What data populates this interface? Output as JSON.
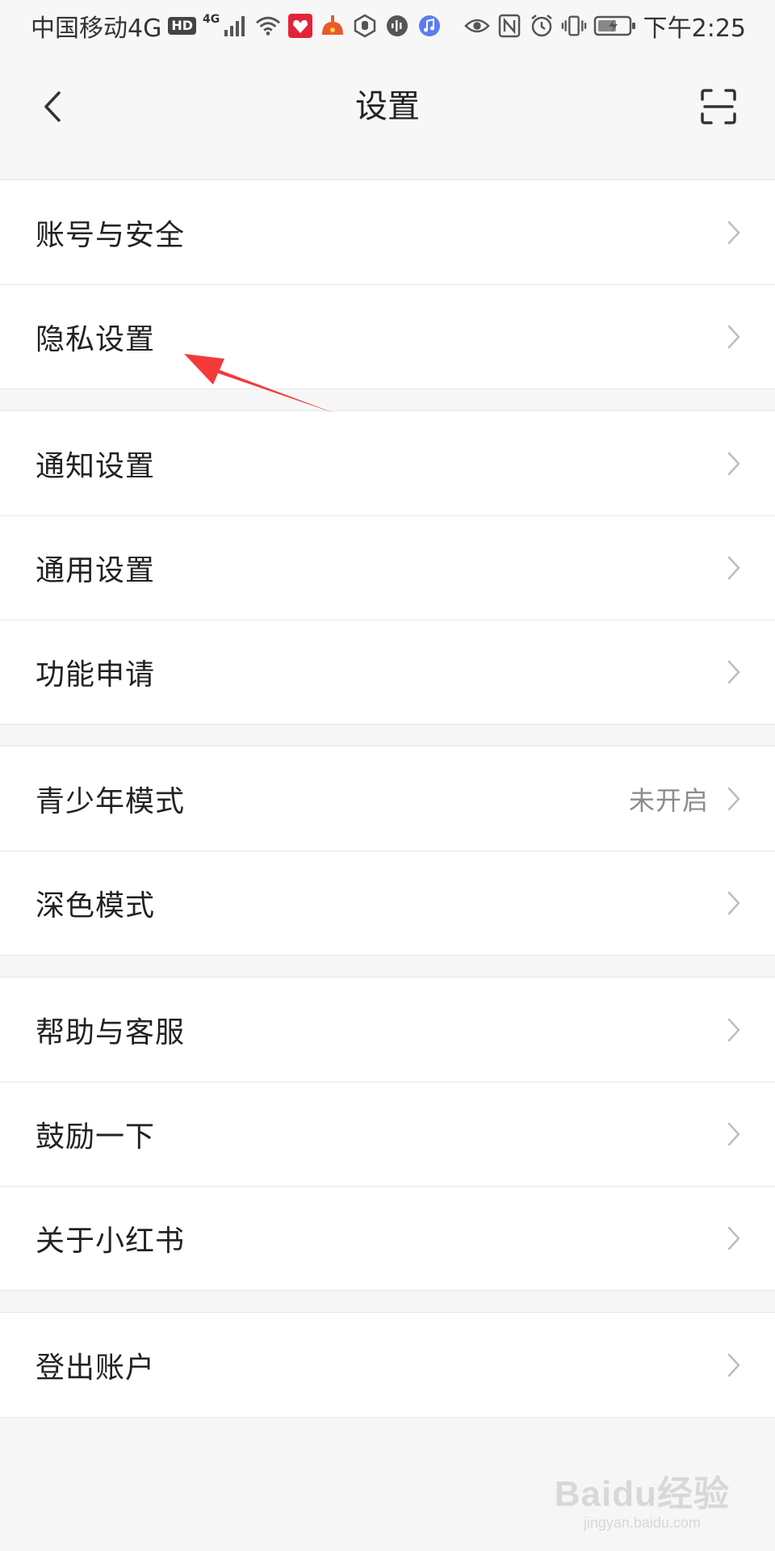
{
  "status_bar": {
    "carrier": "中国移动4G",
    "hd_badge": "HD",
    "network_badge": "4G",
    "time": "下午2:25",
    "icons": [
      "hd-icon",
      "signal-icon",
      "wifi-icon",
      "app-icon",
      "app-icon",
      "app-icon",
      "app-icon",
      "music-icon",
      "eye-icon",
      "nfc-icon",
      "alarm-icon",
      "vibrate-icon",
      "battery-icon"
    ]
  },
  "header": {
    "title": "设置",
    "left_icon": "chevron-left-icon",
    "right_icon": "scan-icon"
  },
  "groups": [
    {
      "items": [
        {
          "label": "账号与安全"
        },
        {
          "label": "隐私设置"
        }
      ]
    },
    {
      "items": [
        {
          "label": "通知设置"
        },
        {
          "label": "通用设置"
        },
        {
          "label": "功能申请"
        }
      ]
    },
    {
      "items": [
        {
          "label": "青少年模式",
          "value": "未开启"
        },
        {
          "label": "深色模式"
        }
      ]
    },
    {
      "items": [
        {
          "label": "帮助与客服"
        },
        {
          "label": "鼓励一下"
        },
        {
          "label": "关于小红书"
        }
      ]
    },
    {
      "items": [
        {
          "label": "登出账户"
        }
      ]
    }
  ],
  "watermark": {
    "brand": "Baidu经验",
    "url": "jingyan.baidu.com"
  },
  "colors": {
    "annotation_arrow": "#f23a3a",
    "background": "#f6f6f6",
    "row_background": "#ffffff"
  }
}
